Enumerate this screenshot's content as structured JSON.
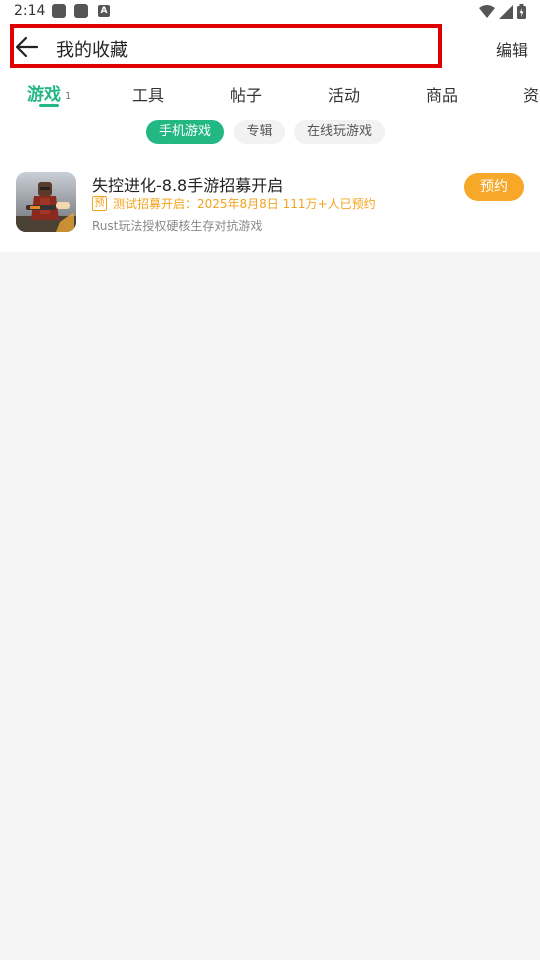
{
  "status_bar": {
    "time": "2:14",
    "icons_left": [
      "notification-square-icon",
      "notification-square-icon",
      "app-a-icon"
    ],
    "icons_right": [
      "wifi-icon",
      "signal-icon",
      "battery-icon"
    ]
  },
  "header": {
    "title": "我的收藏",
    "edit_label": "编辑"
  },
  "tabs": [
    {
      "label": "游戏",
      "count": "1",
      "active": true
    },
    {
      "label": "工具",
      "active": false
    },
    {
      "label": "帖子",
      "active": false
    },
    {
      "label": "活动",
      "active": false
    },
    {
      "label": "商品",
      "active": false
    },
    {
      "label": "资",
      "active": false
    }
  ],
  "chips": [
    {
      "label": "手机游戏",
      "active": true
    },
    {
      "label": "专辑",
      "active": false
    },
    {
      "label": "在线玩游戏",
      "active": false
    }
  ],
  "games": [
    {
      "title": "失控进化-8.8手游招募开启",
      "badge": "预",
      "meta": "测试招募开启：2025年8月8日   111万+人已预约",
      "description": "Rust玩法授权硬核生存对抗游戏",
      "action_label": "预约"
    }
  ],
  "colors": {
    "accent": "#23b883",
    "reserve": "#f7a829",
    "highlight_box": "#e00000"
  }
}
